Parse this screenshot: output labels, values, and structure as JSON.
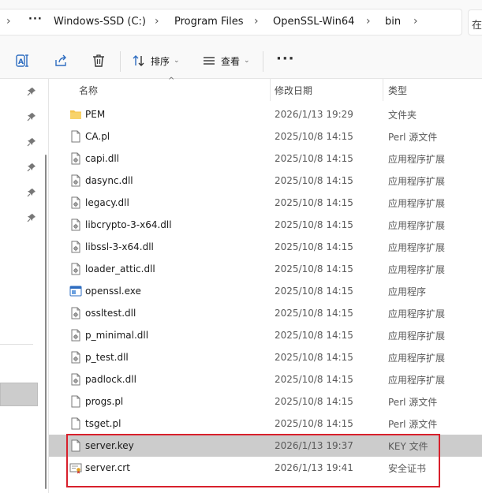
{
  "address_bar": {
    "overflow": "···",
    "crumbs": [
      "Windows-SSD (C:)",
      "Program Files",
      "OpenSSL-Win64",
      "bin"
    ],
    "search_fragment": "在"
  },
  "toolbar": {
    "sort_label": "排序",
    "view_label": "查看",
    "more_label": "···"
  },
  "columns": {
    "name": "名称",
    "modified": "修改日期",
    "type": "类型"
  },
  "files": [
    {
      "name": "PEM",
      "date": "2026/1/13 19:29",
      "type": "文件夹",
      "icon": "folder-icon"
    },
    {
      "name": "CA.pl",
      "date": "2025/10/8 14:15",
      "type": "Perl 源文件",
      "icon": "file-icon"
    },
    {
      "name": "capi.dll",
      "date": "2025/10/8 14:15",
      "type": "应用程序扩展",
      "icon": "dll-icon"
    },
    {
      "name": "dasync.dll",
      "date": "2025/10/8 14:15",
      "type": "应用程序扩展",
      "icon": "dll-icon"
    },
    {
      "name": "legacy.dll",
      "date": "2025/10/8 14:15",
      "type": "应用程序扩展",
      "icon": "dll-icon"
    },
    {
      "name": "libcrypto-3-x64.dll",
      "date": "2025/10/8 14:15",
      "type": "应用程序扩展",
      "icon": "dll-icon"
    },
    {
      "name": "libssl-3-x64.dll",
      "date": "2025/10/8 14:15",
      "type": "应用程序扩展",
      "icon": "dll-icon"
    },
    {
      "name": "loader_attic.dll",
      "date": "2025/10/8 14:15",
      "type": "应用程序扩展",
      "icon": "dll-icon"
    },
    {
      "name": "openssl.exe",
      "date": "2025/10/8 14:15",
      "type": "应用程序",
      "icon": "exe-icon"
    },
    {
      "name": "ossltest.dll",
      "date": "2025/10/8 14:15",
      "type": "应用程序扩展",
      "icon": "dll-icon"
    },
    {
      "name": "p_minimal.dll",
      "date": "2025/10/8 14:15",
      "type": "应用程序扩展",
      "icon": "dll-icon"
    },
    {
      "name": "p_test.dll",
      "date": "2025/10/8 14:15",
      "type": "应用程序扩展",
      "icon": "dll-icon"
    },
    {
      "name": "padlock.dll",
      "date": "2025/10/8 14:15",
      "type": "应用程序扩展",
      "icon": "dll-icon"
    },
    {
      "name": "progs.pl",
      "date": "2025/10/8 14:15",
      "type": "Perl 源文件",
      "icon": "file-icon"
    },
    {
      "name": "tsget.pl",
      "date": "2025/10/8 14:15",
      "type": "Perl 源文件",
      "icon": "file-icon"
    },
    {
      "name": "server.key",
      "date": "2026/1/13 19:37",
      "type": "KEY 文件",
      "icon": "file-icon"
    },
    {
      "name": "server.crt",
      "date": "2026/1/13 19:41",
      "type": "安全证书",
      "icon": "certificate-icon"
    }
  ],
  "selected_index": 15,
  "colors": {
    "selection": "#cccccc",
    "highlight_border": "#d8202c",
    "folder": "#f4c44e"
  }
}
